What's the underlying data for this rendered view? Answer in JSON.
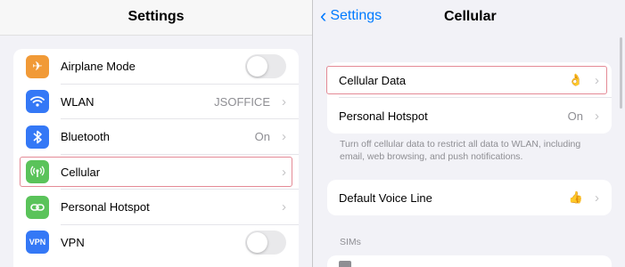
{
  "left": {
    "title": "Settings",
    "items": [
      {
        "label": "Airplane Mode",
        "value": "",
        "icon": "airplane-icon",
        "color": "#f19a37",
        "control": "toggle"
      },
      {
        "label": "WLAN",
        "value": "JSOFFICE",
        "icon": "wifi-icon",
        "color": "#3478f6",
        "control": "chevron"
      },
      {
        "label": "Bluetooth",
        "value": "On",
        "icon": "bluetooth-icon",
        "color": "#3478f6",
        "control": "chevron"
      },
      {
        "label": "Cellular",
        "value": "",
        "icon": "cellular-icon",
        "color": "#5ac35a",
        "control": "chevron"
      },
      {
        "label": "Personal Hotspot",
        "value": "",
        "icon": "hotspot-icon",
        "color": "#5ac35a",
        "control": "chevron"
      },
      {
        "label": "VPN",
        "value": "",
        "icon": "vpn-icon",
        "color": "#3478f6",
        "control": "toggle",
        "icon_text": "VPN"
      }
    ]
  },
  "right": {
    "back_label": "Settings",
    "title": "Cellular",
    "cellular_data_label": "Cellular Data",
    "cellular_data_emoji": "👌",
    "hotspot_label": "Personal Hotspot",
    "hotspot_value": "On",
    "footnote": "Turn off cellular data to restrict all data to WLAN, including email, web browsing, and push notifications.",
    "voice_label": "Default Voice Line",
    "voice_emoji": "👍",
    "sims_header": "SIMs"
  },
  "colors": {
    "accent": "#007aff",
    "highlight": "#e48a96"
  }
}
